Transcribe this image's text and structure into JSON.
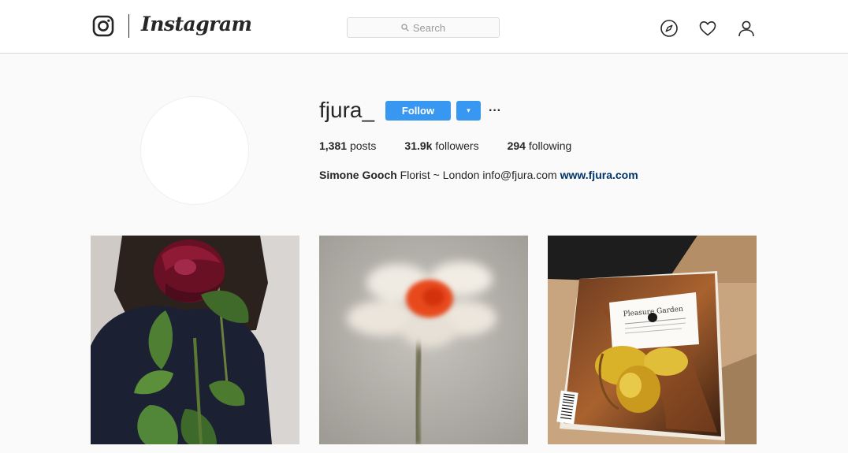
{
  "header": {
    "brand": "Instagram",
    "search_placeholder": "Search",
    "icons": [
      "instagram-logo-icon",
      "search-icon",
      "compass-icon",
      "heart-icon",
      "user-icon"
    ]
  },
  "profile": {
    "username": "fjura_",
    "follow_label": "Follow",
    "dropdown_glyph": "▾",
    "more_glyph": "···",
    "stats": {
      "posts_count": "1,381",
      "posts_label": "posts",
      "followers_count": "31.9k",
      "followers_label": "followers",
      "following_count": "294",
      "following_label": "following"
    },
    "bio": {
      "full_name": "Simone Gooch",
      "text": " Florist ~ London info@fjura.com ",
      "website": "www.fjura.com"
    }
  },
  "posts": {
    "post3_card_title": "Pleasure Garden"
  },
  "colors": {
    "accent": "#3897f0",
    "link": "#003569",
    "background": "#fafafa",
    "border": "#dbdbdb"
  }
}
